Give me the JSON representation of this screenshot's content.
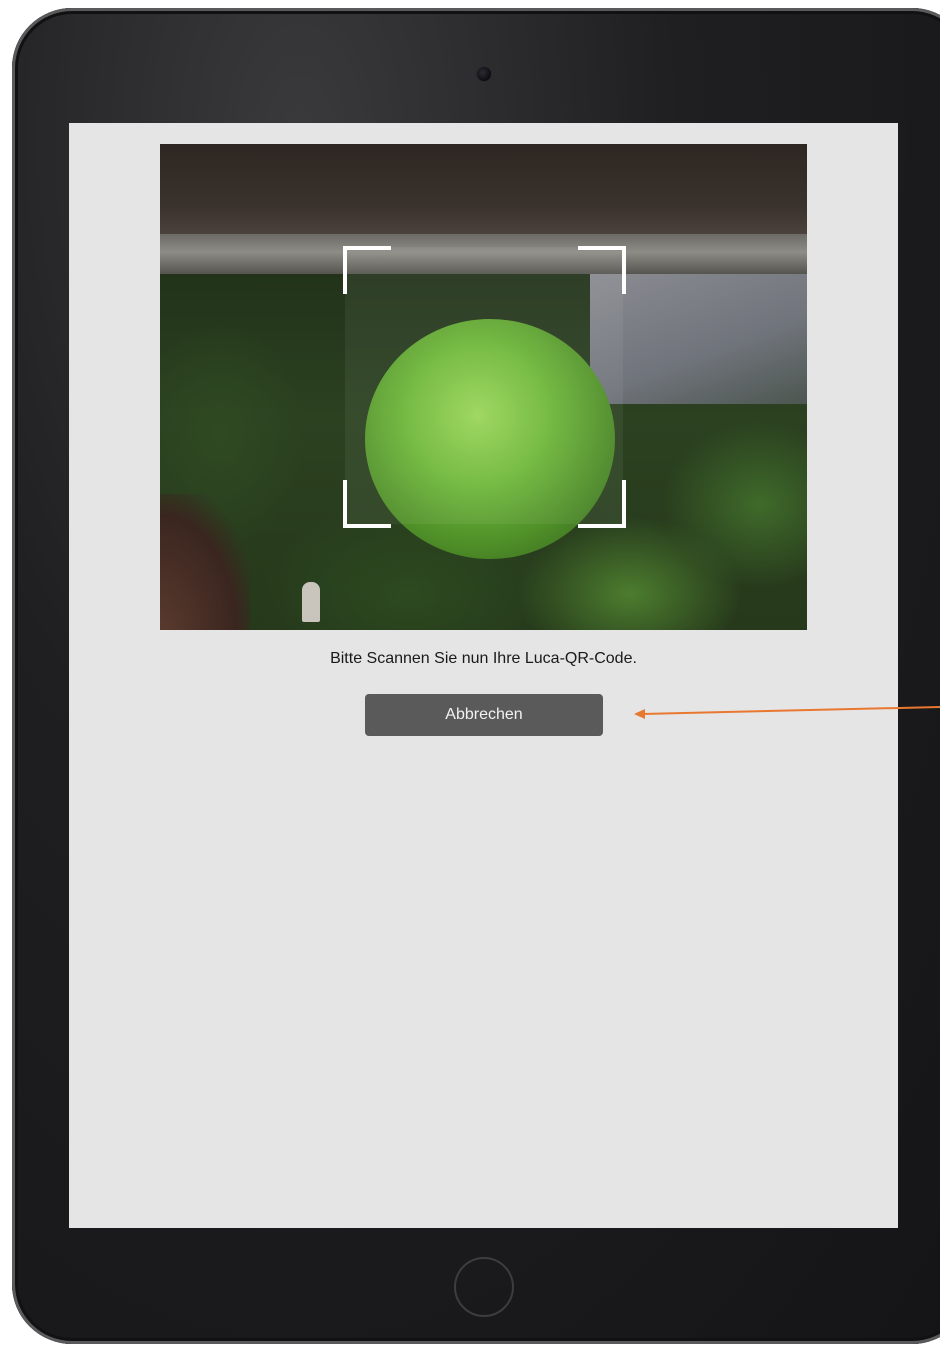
{
  "scanner": {
    "instruction": "Bitte Scannen Sie nun Ihre Luca-QR-Code.",
    "cancel_label": "Abbrechen"
  },
  "colors": {
    "screen_background": "#e5e5e5",
    "button_background": "#5a5a5a",
    "button_text": "#f2f2f2",
    "annotation_arrow": "#e8782f",
    "device_bezel": "#1f1f21"
  },
  "icons": {
    "camera": "front-camera-icon",
    "home": "home-button-icon",
    "scan_frame": "scan-frame-corners"
  }
}
